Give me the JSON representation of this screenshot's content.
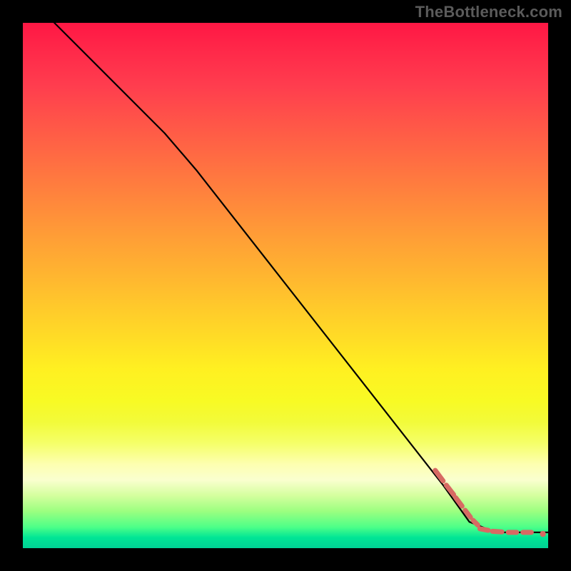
{
  "watermark": "TheBottleneck.com",
  "chart_data": {
    "type": "line",
    "title": "",
    "xlabel": "",
    "ylabel": "",
    "xlim": [
      0,
      100
    ],
    "ylim": [
      0,
      100
    ],
    "series": [
      {
        "name": "curve",
        "points": [
          {
            "x": 6,
            "y": 100
          },
          {
            "x": 27,
            "y": 79
          },
          {
            "x": 33,
            "y": 72
          },
          {
            "x": 80,
            "y": 12
          },
          {
            "x": 85,
            "y": 5
          },
          {
            "x": 90,
            "y": 3
          },
          {
            "x": 100,
            "y": 3
          }
        ]
      }
    ],
    "marker_groups": [
      {
        "name": "diagonal-dashes",
        "style": "dash",
        "items": [
          {
            "x1": 78.5,
            "y1": 14.8,
            "x2": 80.0,
            "y2": 12.8
          },
          {
            "x1": 80.6,
            "y1": 12.0,
            "x2": 82.0,
            "y2": 10.2
          },
          {
            "x1": 82.4,
            "y1": 9.6,
            "x2": 83.6,
            "y2": 8.0
          },
          {
            "x1": 84.2,
            "y1": 7.2,
            "x2": 85.2,
            "y2": 5.9
          },
          {
            "x1": 85.7,
            "y1": 5.3,
            "x2": 86.6,
            "y2": 4.4
          }
        ]
      },
      {
        "name": "flat-dashes",
        "style": "dash",
        "items": [
          {
            "x1": 87.0,
            "y1": 3.7,
            "x2": 88.6,
            "y2": 3.4
          },
          {
            "x1": 89.4,
            "y1": 3.2,
            "x2": 91.2,
            "y2": 3.1
          },
          {
            "x1": 92.4,
            "y1": 3.0,
            "x2": 94.0,
            "y2": 3.0
          },
          {
            "x1": 95.2,
            "y1": 3.0,
            "x2": 96.8,
            "y2": 3.0
          }
        ]
      },
      {
        "name": "end-dot",
        "style": "dot",
        "items": [
          {
            "x": 99.0,
            "y": 2.7
          }
        ]
      }
    ]
  }
}
